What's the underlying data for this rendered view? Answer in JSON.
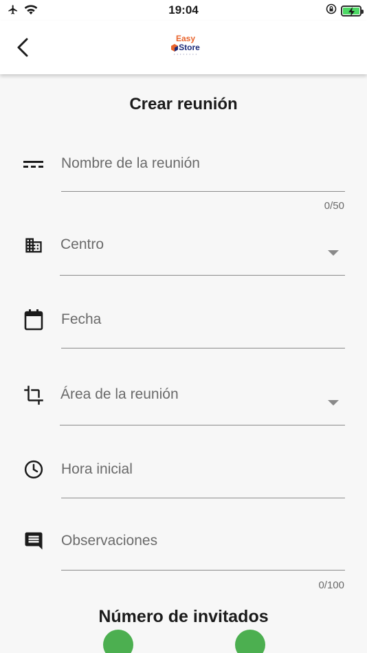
{
  "status_bar": {
    "time": "19:04",
    "icons": [
      "airplane-icon",
      "wifi-icon",
      "orientation-lock-icon",
      "battery-charging-icon"
    ],
    "battery_color": "#4cd964"
  },
  "app_bar": {
    "back_icon": "chevron-left-icon",
    "logo_line1": "Easy",
    "logo_line2": "Store",
    "brand_colors": {
      "orange": "#e8632b",
      "navy": "#1d2c7a"
    }
  },
  "form": {
    "title": "Crear reunión",
    "fields": [
      {
        "icon": "short-text-icon",
        "label": "Nombre de la reunión",
        "counter": "0/50"
      },
      {
        "icon": "building-icon",
        "label": "Centro",
        "dropdown": true
      },
      {
        "icon": "calendar-icon",
        "label": "Fecha"
      },
      {
        "icon": "crop-icon",
        "label": "Área de la reunión",
        "dropdown": true
      },
      {
        "icon": "clock-icon",
        "label": "Hora inicial"
      },
      {
        "icon": "comment-icon",
        "label": "Observaciones",
        "counter": "0/100"
      }
    ],
    "guests_title": "Número de invitados",
    "accent_color": "#4caf50"
  }
}
